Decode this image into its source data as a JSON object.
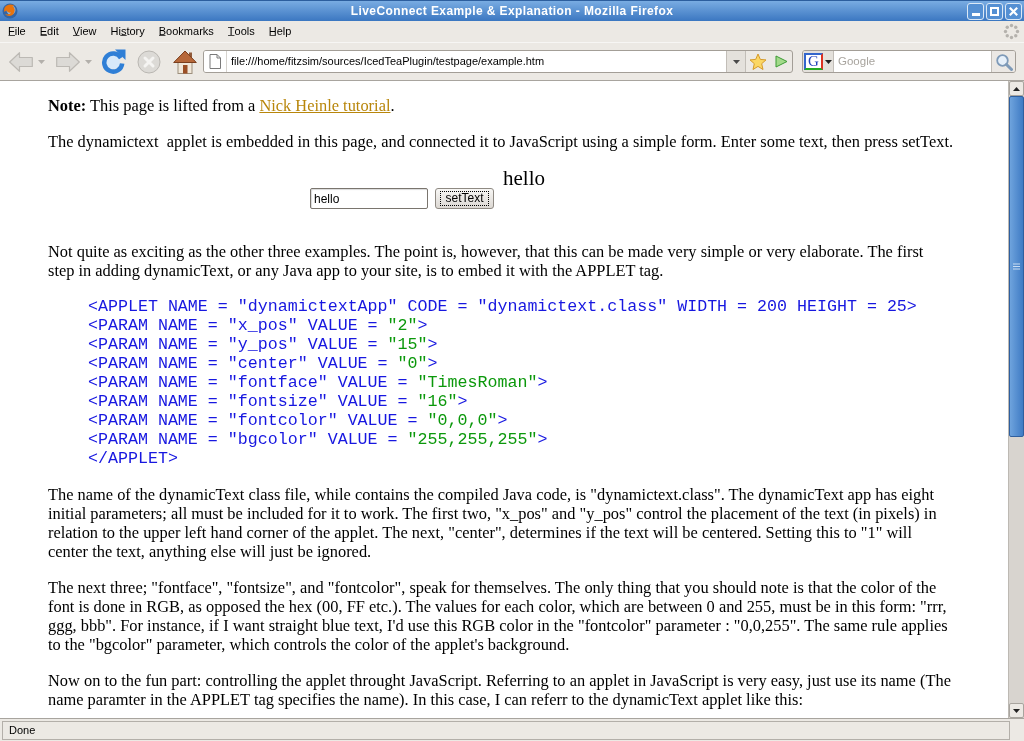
{
  "window": {
    "title": "LiveConnect Example & Explanation - Mozilla Firefox"
  },
  "menu_bar": [
    {
      "label": "F̲ile"
    },
    {
      "label": "E̲dit"
    },
    {
      "label": "V̲iew"
    },
    {
      "label": "His̲tory"
    },
    {
      "label": "B̲ookmarks"
    },
    {
      "label": "T̲ools"
    },
    {
      "label": "H̲elp"
    }
  ],
  "toolbar": {
    "buttons": [
      {
        "kind": "back",
        "disabled": true
      },
      {
        "kind": "forward",
        "disabled": true
      },
      {
        "kind": "reload",
        "disabled": false
      },
      {
        "kind": "stop",
        "disabled": true
      },
      {
        "kind": "home",
        "disabled": false
      }
    ],
    "url_bar": {
      "value": "file:///home/fitzsim/sources/IcedTeaPlugin/testpage/example.htm"
    },
    "search": {
      "engine_letter": "G",
      "placeholder": "Google"
    }
  },
  "page": [
    {
      "kind": "paragraph",
      "runs": [
        {
          "kind": "text",
          "text": "**Note:** This page is lifted from a "
        },
        {
          "kind": "link",
          "text": "Nick Heinle tutorial"
        },
        {
          "kind": "text",
          "text": "."
        }
      ]
    },
    {
      "kind": "paragraph",
      "lines": [
        "The dynamictext  applet is embedded in this page, and connected it to JavaScript using a simple form. Enter some text, then press setText."
      ]
    },
    {
      "kind": "form",
      "input": {
        "value": "hello"
      },
      "button": {
        "label": "setText",
        "focused": true
      },
      "applet_text": "hello"
    },
    {
      "kind": "paragraph",
      "lines": [
        "Not quite as exciting as the other three examples. The point is, however, that this can be made very simple or very elaborate. The first",
        "step in adding dynamicText, or any Java app to your site, is to embed it with the APPLET tag."
      ]
    },
    {
      "kind": "code",
      "lines": [
        [
          {
            "kind": "markup",
            "text": "<APPLET NAME = \"dynamictextApp\" CODE = \"dynamictext.class\" WIDTH = 200 HEIGHT = 25>"
          }
        ],
        [
          {
            "kind": "markup",
            "text": "<PARAM NAME = \"x_pos\" VALUE = "
          },
          {
            "kind": "value",
            "text": "\"2\""
          },
          {
            "kind": "markup",
            "text": ">"
          }
        ],
        [
          {
            "kind": "markup",
            "text": "<PARAM NAME = \"y_pos\" VALUE = "
          },
          {
            "kind": "value",
            "text": "\"15\""
          },
          {
            "kind": "markup",
            "text": ">"
          }
        ],
        [
          {
            "kind": "markup",
            "text": "<PARAM NAME = \"center\" VALUE = "
          },
          {
            "kind": "value",
            "text": "\"0\""
          },
          {
            "kind": "markup",
            "text": ">"
          }
        ],
        [
          {
            "kind": "markup",
            "text": "<PARAM NAME = \"fontface\" VALUE = "
          },
          {
            "kind": "value",
            "text": "\"TimesRoman\""
          },
          {
            "kind": "markup",
            "text": ">"
          }
        ],
        [
          {
            "kind": "markup",
            "text": "<PARAM NAME = \"fontsize\" VALUE = "
          },
          {
            "kind": "value",
            "text": "\"16\""
          },
          {
            "kind": "markup",
            "text": ">"
          }
        ],
        [
          {
            "kind": "markup",
            "text": "<PARAM NAME = \"fontcolor\" VALUE = "
          },
          {
            "kind": "value",
            "text": "\"0,0,0\""
          },
          {
            "kind": "markup",
            "text": ">"
          }
        ],
        [
          {
            "kind": "markup",
            "text": "<PARAM NAME = \"bgcolor\" VALUE = "
          },
          {
            "kind": "value",
            "text": "\"255,255,255\""
          },
          {
            "kind": "markup",
            "text": ">"
          }
        ],
        [
          {
            "kind": "markup",
            "text": "</APPLET>"
          }
        ]
      ]
    },
    {
      "kind": "paragraph",
      "lines": [
        "The name of the dynamicText class file, while contains the compiled Java code, is \"dynamictext.class\". The dynamicText app has eight",
        "initial parameters; all must be included for it to work. The first two, \"x_pos\" and \"y_pos\" control the placement of the text (in pixels) in",
        "relation to the upper left hand corner of the applet. The next, \"center\", determines if the text will be centered. Setting this to \"1\" will",
        "center the text, anything else will just be ignored."
      ]
    },
    {
      "kind": "paragraph",
      "lines": [
        "The next three; \"fontface\", \"fontsize\", and \"fontcolor\", speak for themselves. The only thing that you should note is that the color of the",
        "font is done in RGB, as opposed the hex (00, FF etc.). The values for each color, which are between 0 and 255, must be in this form: \"rrr,",
        "ggg, bbb\". For instance, if I want straight blue text, I'd use this RGB color in the \"fontcolor\" parameter : \"0,0,255\". The same rule applies",
        "to the \"bgcolor\" parameter, which controls the color of the applet's background."
      ]
    },
    {
      "kind": "paragraph",
      "lines": [
        "Now on to the fun part: controlling the applet throught JavaScript. Referring to an applet in JavaScript is very easy, just use its name (The",
        "name paramter in the APPLET tag specifies the name). In this case, I can referr to the dynamicText applet like this:"
      ]
    }
  ],
  "status_bar": {
    "text": "Done"
  }
}
